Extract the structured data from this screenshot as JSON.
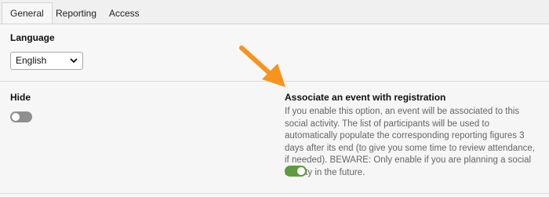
{
  "tabs": [
    {
      "label": "General",
      "active": true
    },
    {
      "label": "Reporting",
      "active": false
    },
    {
      "label": "Access",
      "active": false
    }
  ],
  "language": {
    "label": "Language",
    "selected": "English"
  },
  "hide": {
    "label": "Hide",
    "enabled": false
  },
  "associate": {
    "title": "Associate an event with registration",
    "description": "If you enable this option, an event will be associated to this social activity. The list of participants will be used to automatically populate the corresponding reporting figures 3 days after its end (to give you some time to review attendance, if needed). BEWARE: Only enable if you are planning a social activity in the future.",
    "enabled": true
  },
  "colors": {
    "toggle_on": "#5f9b3e",
    "toggle_off": "#8f8f8f",
    "arrow": "#f7941d"
  }
}
